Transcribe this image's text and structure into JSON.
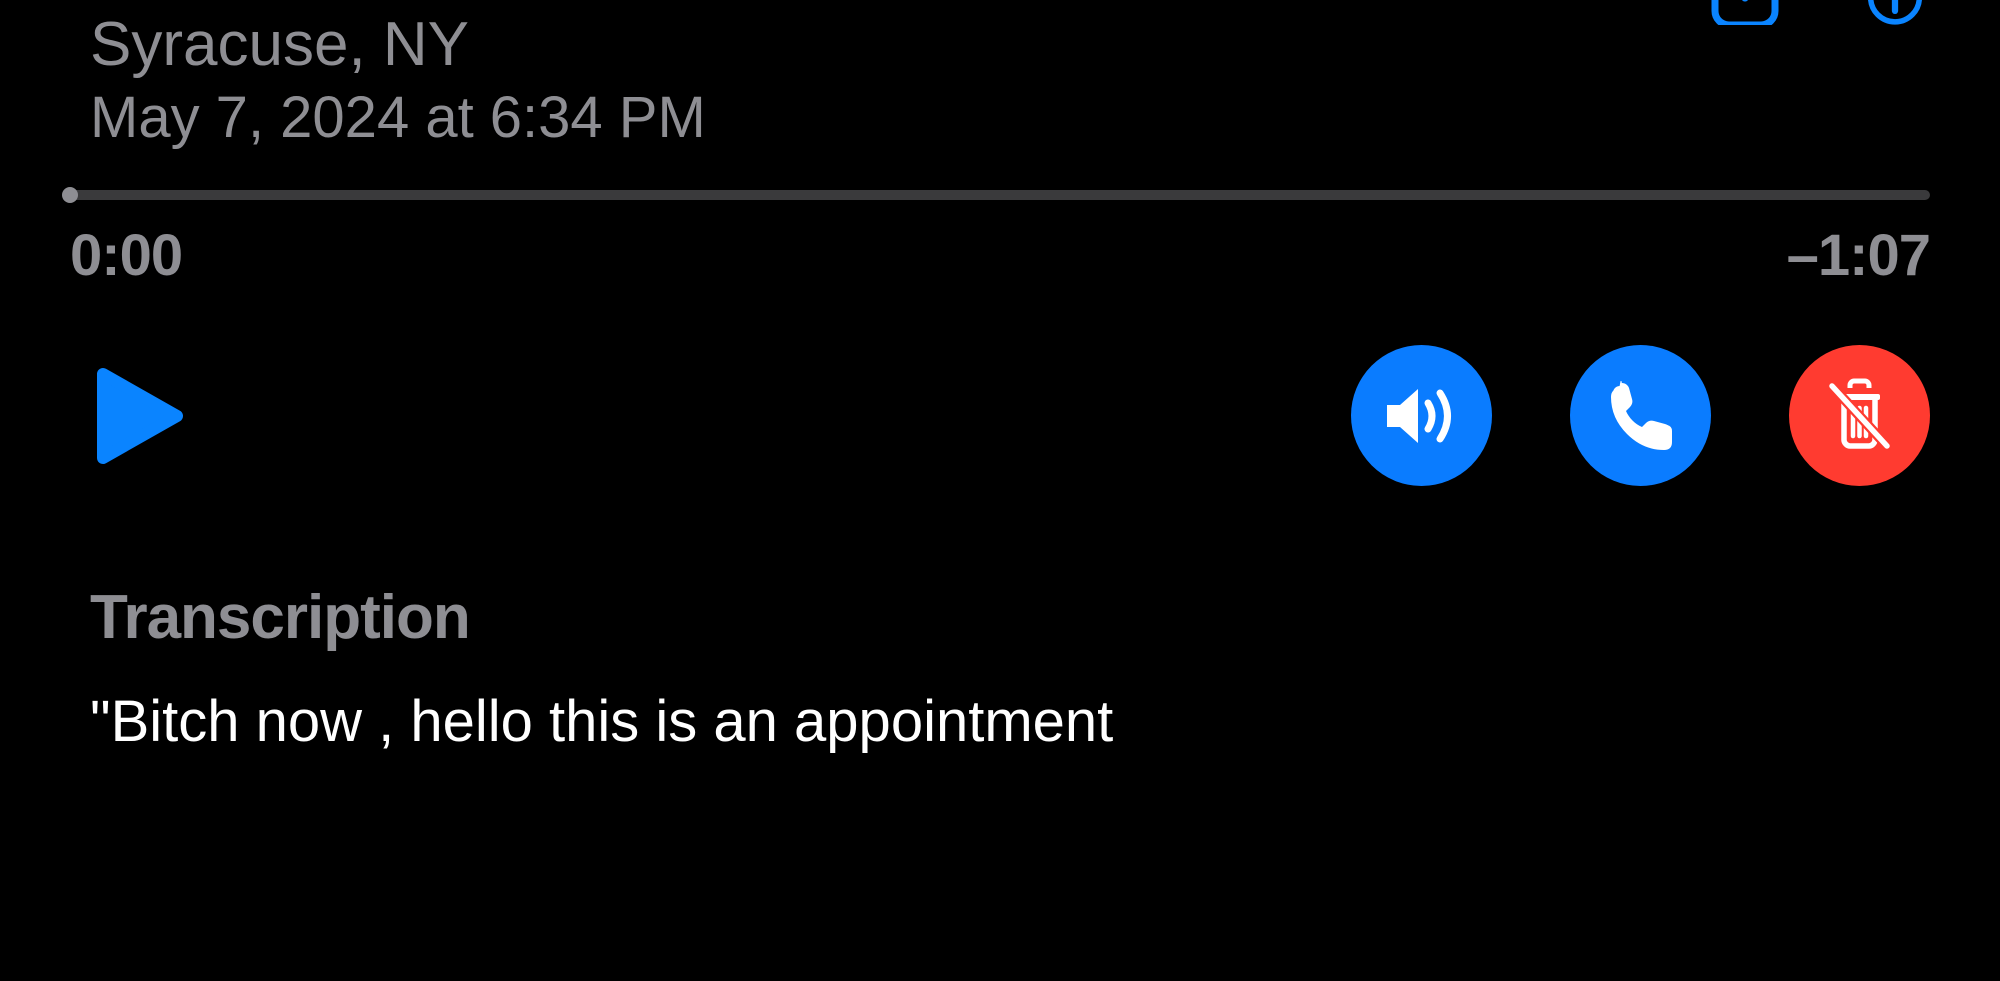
{
  "location": "Syracuse, NY",
  "datetime": "May 7, 2024 at 6:34 PM",
  "playback": {
    "current_time": "0:00",
    "remaining_time": "–1:07"
  },
  "transcription": {
    "heading": "Transcription",
    "body": "\"Bitch now , hello this is an appointment"
  },
  "icons": {
    "share": "share-icon",
    "info": "info-icon",
    "play": "play-icon",
    "speaker": "speaker-icon",
    "call": "phone-icon",
    "delete": "trash-slash-icon"
  },
  "colors": {
    "accent_blue": "#0a84ff",
    "button_blue": "#0a7cff",
    "destructive_red": "#ff3b30",
    "secondary_text": "#8e8e93"
  }
}
